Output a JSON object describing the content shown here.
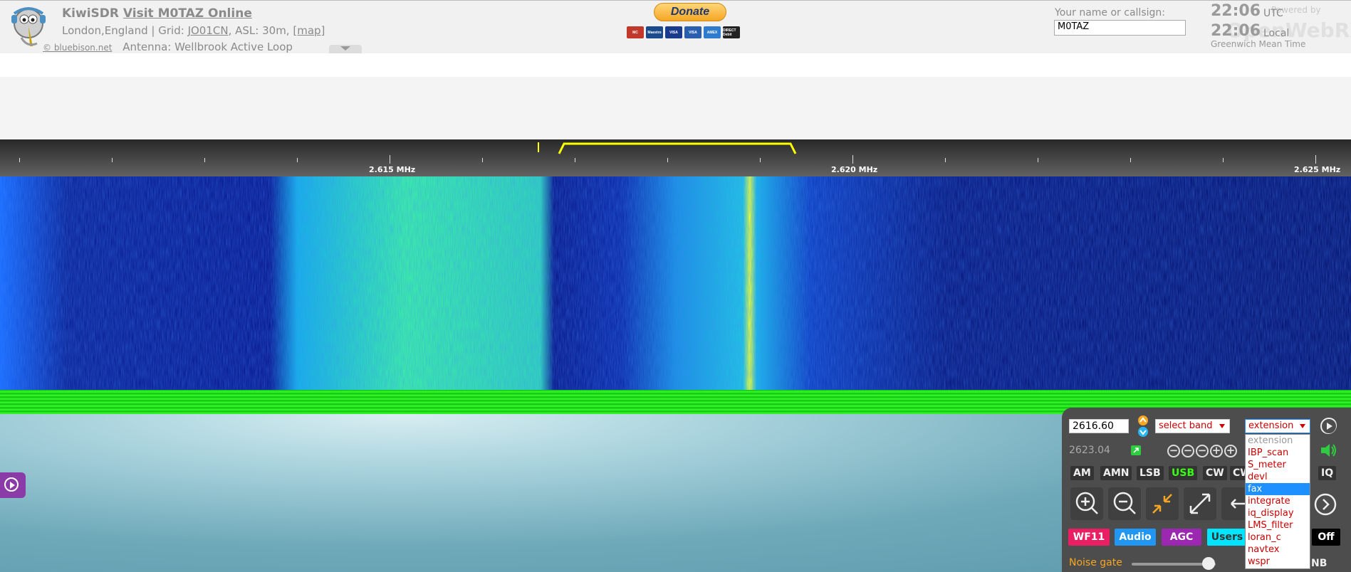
{
  "header": {
    "brand": "KiwiSDR",
    "visit_link": "Visit M0TAZ Online",
    "location": "London,England",
    "grid_label": "Grid:",
    "grid": "JO01CN",
    "asl": "ASL: 30m,",
    "map_link": "[map]",
    "copyright": "© bluebison.net",
    "antenna": "Antenna: Wellbrook Active Loop"
  },
  "donate": {
    "label": "Donate",
    "cards": [
      "MC",
      "Maestro",
      "VISA",
      "VISA",
      "AMEX",
      "DIRECT Debit"
    ]
  },
  "user": {
    "label": "Your name or callsign:",
    "value": "M0TAZ"
  },
  "clock": {
    "utc_time": "22:06",
    "utc_label": "UTC",
    "local_time": "22:06",
    "local_label": "Local",
    "timezone": "Greenwich Mean Time",
    "powered_by": "Powered by",
    "openrx": "OpenWebRX"
  },
  "scale": {
    "labels": [
      "2.615 MHz",
      "2.620 MHz",
      "2.625 MHz"
    ]
  },
  "panel": {
    "frequency": "2616.60",
    "frequency_secondary": "2623.04",
    "band_select": "select band",
    "extension_select": "extension",
    "modes": [
      "AM",
      "AMN",
      "LSB",
      "USB",
      "CW",
      "CW",
      "IQ"
    ],
    "active_mode": "USB",
    "buttons": {
      "wf": "WF11",
      "audio": "Audio",
      "agc": "AGC",
      "users": "Users",
      "off": "Off"
    },
    "noise_gate_label": "Noise gate",
    "noise_gate_level": 0.78,
    "nb_label": "NB"
  },
  "extension_dropdown": {
    "options": [
      "extension",
      "IBP_scan",
      "S_meter",
      "devl",
      "fax",
      "integrate",
      "iq_display",
      "LMS_filter",
      "loran_c",
      "navtex",
      "wspr"
    ],
    "selected": "fax"
  },
  "colors": {
    "waterfall_base": "#0a1880",
    "spectrum": "#39ff2a",
    "passband": "#ffff00",
    "panel": "#4d4d4d",
    "wf_button": "#e91e63",
    "audio_button": "#2196f3",
    "agc_button": "#9c27b0",
    "users_button": "#00e5ff",
    "usb_active": "#39ff14"
  }
}
